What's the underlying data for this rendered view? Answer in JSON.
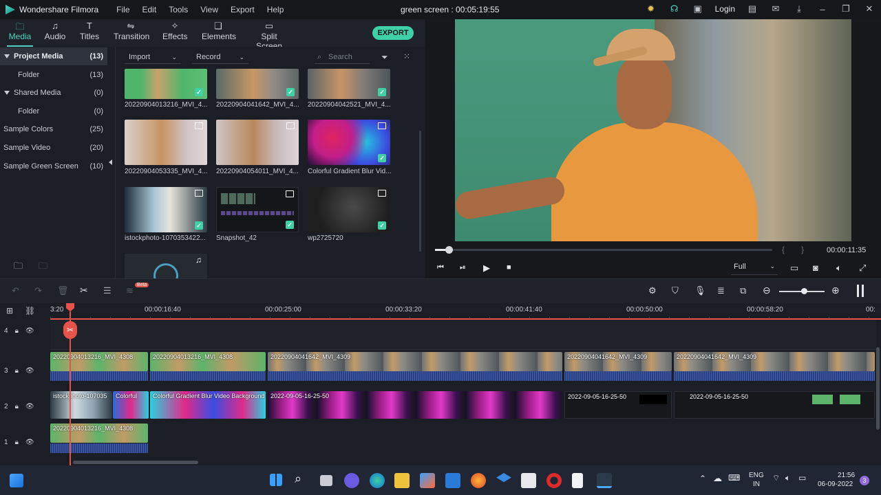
{
  "app": {
    "name": "Wondershare Filmora",
    "project_title": "green screen : 00:05:19:55",
    "menu": [
      "File",
      "Edit",
      "Tools",
      "View",
      "Export",
      "Help"
    ],
    "login_label": "Login"
  },
  "tabs": [
    {
      "label": "Media",
      "icon": "folder-icon",
      "active": true
    },
    {
      "label": "Audio",
      "icon": "music-note-icon"
    },
    {
      "label": "Titles",
      "icon": "text-t-icon"
    },
    {
      "label": "Transition",
      "icon": "transition-icon"
    },
    {
      "label": "Effects",
      "icon": "effects-sparkle-icon"
    },
    {
      "label": "Elements",
      "icon": "elements-icon"
    },
    {
      "label": "Split Screen",
      "icon": "split-screen-icon"
    }
  ],
  "export_label": "EXPORT",
  "sidebar": {
    "items": [
      {
        "label": "Project Media",
        "count": "(13)"
      },
      {
        "label": "Folder",
        "count": "(13)"
      },
      {
        "label": "Shared Media",
        "count": "(0)"
      },
      {
        "label": "Folder",
        "count": "(0)"
      },
      {
        "label": "Sample Colors",
        "count": "(25)"
      },
      {
        "label": "Sample Video",
        "count": "(20)"
      },
      {
        "label": "Sample Green Screen",
        "count": "(10)"
      }
    ]
  },
  "media": {
    "import_label": "Import",
    "record_label": "Record",
    "search_placeholder": "Search",
    "items": [
      {
        "label": "20220904013216_MVI_4..."
      },
      {
        "label": "20220904041642_MVI_4..."
      },
      {
        "label": "20220904042521_MVI_4..."
      },
      {
        "label": "20220904053335_MVI_4..."
      },
      {
        "label": "20220904054011_MVI_4..."
      },
      {
        "label": "Colorful Gradient Blur Vid..."
      },
      {
        "label": "istockphoto-1070353422..."
      },
      {
        "label": "Snapshot_42"
      },
      {
        "label": "wp2725720"
      }
    ]
  },
  "preview": {
    "timecode": "00:00:11:35",
    "quality": "Full",
    "progress": 0.04
  },
  "timeline": {
    "ruler": [
      "3:20",
      "00:00:16:40",
      "00:00:25:00",
      "00:00:33:20",
      "00:00:41:40",
      "00:00:50:00",
      "00:00:58:20",
      "00:"
    ],
    "beta_label": "Beta",
    "tracks": [
      {
        "label": "4"
      },
      {
        "label": "3"
      },
      {
        "label": "2"
      },
      {
        "label": "1"
      }
    ],
    "clips": {
      "t3": [
        "20220904013216_MVI_4308",
        "20220904013216_MVI_4308",
        "20220904041642_MVI_4309",
        "20220904041642_MVI_4309",
        "20220904041642_MVI_4309"
      ],
      "t2": [
        "istockphoto-107035",
        "Colorful",
        "Colorful Gradient Blur Video Background",
        "2022-09-05-16-25-50",
        "2022-09-05-16-25-50",
        "2022-09-05-16-25-50"
      ],
      "t1": [
        "20220904013216_MVI_4308"
      ]
    }
  },
  "taskbar": {
    "lang": "ENG",
    "region": "IN",
    "time": "21:56",
    "date": "06-09-2022",
    "notif_count": "3"
  },
  "colors": {
    "accent": "#4fd3c0",
    "export": "#3fd0a6",
    "playhead": "#e5534b"
  }
}
